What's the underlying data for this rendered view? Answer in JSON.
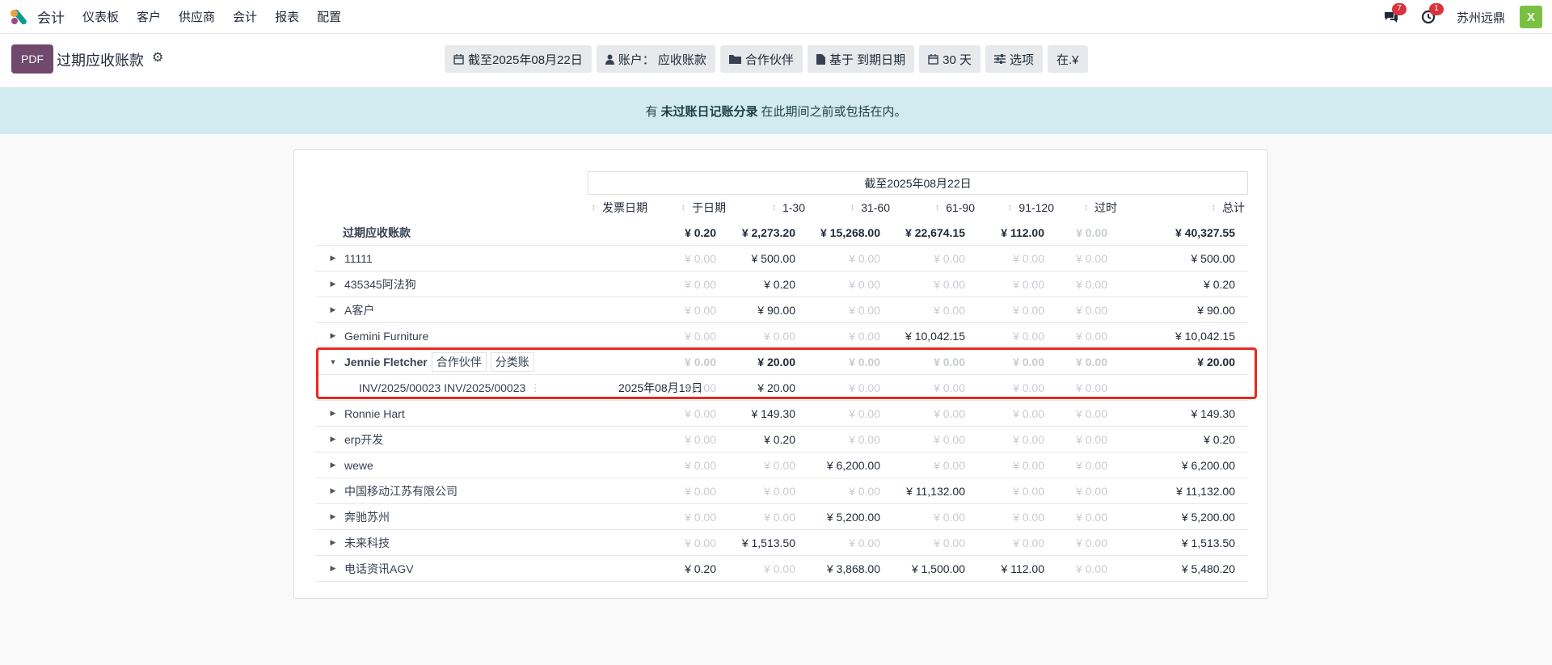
{
  "nav": {
    "app": "会计",
    "items": [
      "仪表板",
      "客户",
      "供应商",
      "会计",
      "报表",
      "配置"
    ],
    "messages_badge": "7",
    "activity_badge": "1",
    "company": "苏州远鼎",
    "avatar": "X"
  },
  "control": {
    "pdf": "PDF",
    "title": "过期应收账款",
    "filters": [
      {
        "icon": "calendar-icon",
        "label": "截至2025年08月22日"
      },
      {
        "icon": "user-icon",
        "label": "账户： 应收账款"
      },
      {
        "icon": "folder-icon",
        "label": "合作伙伴"
      },
      {
        "icon": "file-icon",
        "label": "基于 到期日期"
      },
      {
        "icon": "calendar-icon",
        "label": "30 天"
      },
      {
        "icon": "sliders-icon",
        "label": "选项"
      },
      {
        "icon": "",
        "label": "在.¥"
      }
    ]
  },
  "alert": {
    "pre": "有",
    "bold": "未过账日记账分录",
    "post": "在此期间之前或包括在内。"
  },
  "report": {
    "date_header": "截至2025年08月22日",
    "columns": [
      "发票日期",
      "于日期",
      "1-30",
      "31-60",
      "61-90",
      "91-120",
      "过时",
      "总计"
    ],
    "total_row": {
      "name": "过期应收账款",
      "values": [
        "",
        "¥ 0.20",
        "¥ 2,273.20",
        "¥ 15,268.00",
        "¥ 22,674.15",
        "¥ 112.00",
        "¥ 0.00",
        "¥ 40,327.55"
      ]
    },
    "rows": [
      {
        "name": "11111",
        "values": [
          "",
          "¥ 0.00",
          "¥ 500.00",
          "¥ 0.00",
          "¥ 0.00",
          "¥ 0.00",
          "¥ 0.00",
          "¥ 500.00"
        ]
      },
      {
        "name": "435345阿法狗",
        "values": [
          "",
          "¥ 0.00",
          "¥ 0.20",
          "¥ 0.00",
          "¥ 0.00",
          "¥ 0.00",
          "¥ 0.00",
          "¥ 0.20"
        ]
      },
      {
        "name": "A客户",
        "values": [
          "",
          "¥ 0.00",
          "¥ 90.00",
          "¥ 0.00",
          "¥ 0.00",
          "¥ 0.00",
          "¥ 0.00",
          "¥ 90.00"
        ]
      },
      {
        "name": "Gemini Furniture",
        "values": [
          "",
          "¥ 0.00",
          "¥ 0.00",
          "¥ 0.00",
          "¥ 10,042.15",
          "¥ 0.00",
          "¥ 0.00",
          "¥ 10,042.15"
        ]
      },
      {
        "name": "Jennie Fletcher",
        "expanded": true,
        "tags": [
          "合作伙伴",
          "分类账"
        ],
        "values": [
          "",
          "¥ 0.00",
          "¥ 20.00",
          "¥ 0.00",
          "¥ 0.00",
          "¥ 0.00",
          "¥ 0.00",
          "¥ 20.00"
        ]
      },
      {
        "name": "INV/2025/00023 INV/2025/00023",
        "sub": true,
        "values": [
          "2025年08月19日",
          "¥ 0.00",
          "¥ 20.00",
          "¥ 0.00",
          "¥ 0.00",
          "¥ 0.00",
          "¥ 0.00",
          ""
        ]
      },
      {
        "name": "Ronnie Hart",
        "values": [
          "",
          "¥ 0.00",
          "¥ 149.30",
          "¥ 0.00",
          "¥ 0.00",
          "¥ 0.00",
          "¥ 0.00",
          "¥ 149.30"
        ]
      },
      {
        "name": "erp开发",
        "values": [
          "",
          "¥ 0.00",
          "¥ 0.20",
          "¥ 0.00",
          "¥ 0.00",
          "¥ 0.00",
          "¥ 0.00",
          "¥ 0.20"
        ]
      },
      {
        "name": "wewe",
        "values": [
          "",
          "¥ 0.00",
          "¥ 0.00",
          "¥ 6,200.00",
          "¥ 0.00",
          "¥ 0.00",
          "¥ 0.00",
          "¥ 6,200.00"
        ]
      },
      {
        "name": "中国移动江苏有限公司",
        "values": [
          "",
          "¥ 0.00",
          "¥ 0.00",
          "¥ 0.00",
          "¥ 11,132.00",
          "¥ 0.00",
          "¥ 0.00",
          "¥ 11,132.00"
        ]
      },
      {
        "name": "奔驰苏州",
        "values": [
          "",
          "¥ 0.00",
          "¥ 0.00",
          "¥ 5,200.00",
          "¥ 0.00",
          "¥ 0.00",
          "¥ 0.00",
          "¥ 5,200.00"
        ]
      },
      {
        "name": "未来科技",
        "values": [
          "",
          "¥ 0.00",
          "¥ 1,513.50",
          "¥ 0.00",
          "¥ 0.00",
          "¥ 0.00",
          "¥ 0.00",
          "¥ 1,513.50"
        ]
      },
      {
        "name": "电话资讯AGV",
        "values": [
          "",
          "¥ 0.20",
          "¥ 0.00",
          "¥ 3,868.00",
          "¥ 1,500.00",
          "¥ 112.00",
          "¥ 0.00",
          "¥ 5,480.20"
        ]
      }
    ]
  }
}
